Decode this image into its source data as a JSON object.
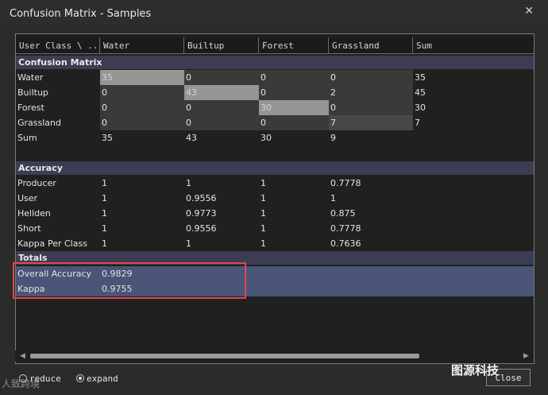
{
  "window": {
    "title": "Confusion Matrix - Samples",
    "close_glyph": "✕"
  },
  "columns": [
    "User Class \\ ...",
    "Water",
    "Builtup",
    "Forest",
    "Grassland",
    "Sum"
  ],
  "sections": {
    "matrix": "Confusion Matrix",
    "accuracy": "Accuracy",
    "totals": "Totals"
  },
  "matrix_rows": [
    {
      "label": "Water",
      "cells": [
        "35",
        "0",
        "0",
        "0",
        "35"
      ]
    },
    {
      "label": "Builtup",
      "cells": [
        "0",
        "43",
        "0",
        "2",
        "45"
      ]
    },
    {
      "label": "Forest",
      "cells": [
        "0",
        "0",
        "30",
        "0",
        "30"
      ]
    },
    {
      "label": "Grassland",
      "cells": [
        "0",
        "0",
        "0",
        "7",
        "7"
      ]
    },
    {
      "label": "Sum",
      "cells": [
        "35",
        "43",
        "30",
        "9",
        ""
      ]
    }
  ],
  "accuracy_rows": [
    {
      "label": "Producer",
      "cells": [
        "1",
        "1",
        "1",
        "0.7778",
        ""
      ]
    },
    {
      "label": "User",
      "cells": [
        "1",
        "0.9556",
        "1",
        "1",
        ""
      ]
    },
    {
      "label": "Hellden",
      "cells": [
        "1",
        "0.9773",
        "1",
        "0.875",
        ""
      ]
    },
    {
      "label": "Short",
      "cells": [
        "1",
        "0.9556",
        "1",
        "0.7778",
        ""
      ]
    },
    {
      "label": "Kappa Per Class",
      "cells": [
        "1",
        "1",
        "1",
        "0.7636",
        ""
      ]
    }
  ],
  "totals_rows": [
    {
      "label": "Overall Accuracy",
      "value": "0.9829"
    },
    {
      "label": "Kappa",
      "value": "0.9755"
    }
  ],
  "options": {
    "reduce": "reduce",
    "expand": "expand",
    "selected": "expand"
  },
  "close_label": "Close",
  "watermark_left": "人致跨境",
  "watermark_right": "图源科技",
  "colors": {
    "section_bg": "#3c3c52",
    "totals_bg": "#4a5577",
    "highlight_border": "#e04848"
  }
}
